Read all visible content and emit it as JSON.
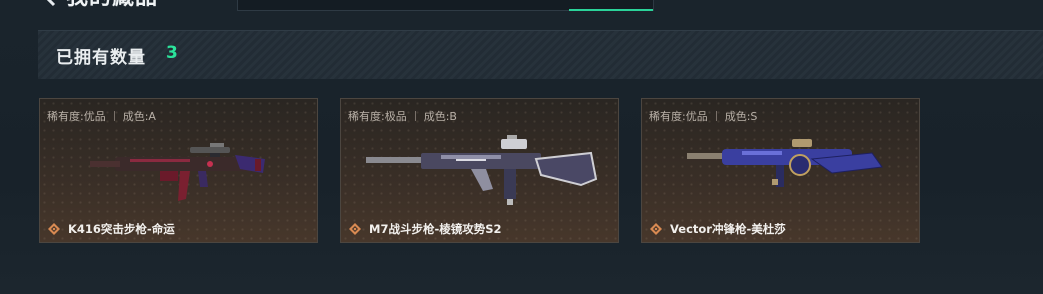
{
  "header": {
    "title": "我的藏品",
    "back_icon": "back-arrow-icon",
    "search_value": ""
  },
  "owned": {
    "label": "已拥有数量",
    "count": "3"
  },
  "cards": [
    {
      "rarity": "稀有度:优品",
      "condition": "成色:A",
      "name": "K416突击步枪-命运",
      "weapon_icon": "assault-rifle-icon",
      "rarity_icon": "diamond-icon",
      "accent": "#d98a52"
    },
    {
      "rarity": "稀有度:极品",
      "condition": "成色:B",
      "name": "M7战斗步枪-棱镜攻势S2",
      "weapon_icon": "battle-rifle-icon",
      "rarity_icon": "diamond-icon",
      "accent": "#d98a52"
    },
    {
      "rarity": "稀有度:优品",
      "condition": "成色:S",
      "name": "Vector冲锋枪-美杜莎",
      "weapon_icon": "smg-icon",
      "rarity_icon": "diamond-icon",
      "accent": "#d98a52"
    }
  ],
  "colors": {
    "count_green": "#2be39b",
    "card_border": "#4c4640"
  }
}
